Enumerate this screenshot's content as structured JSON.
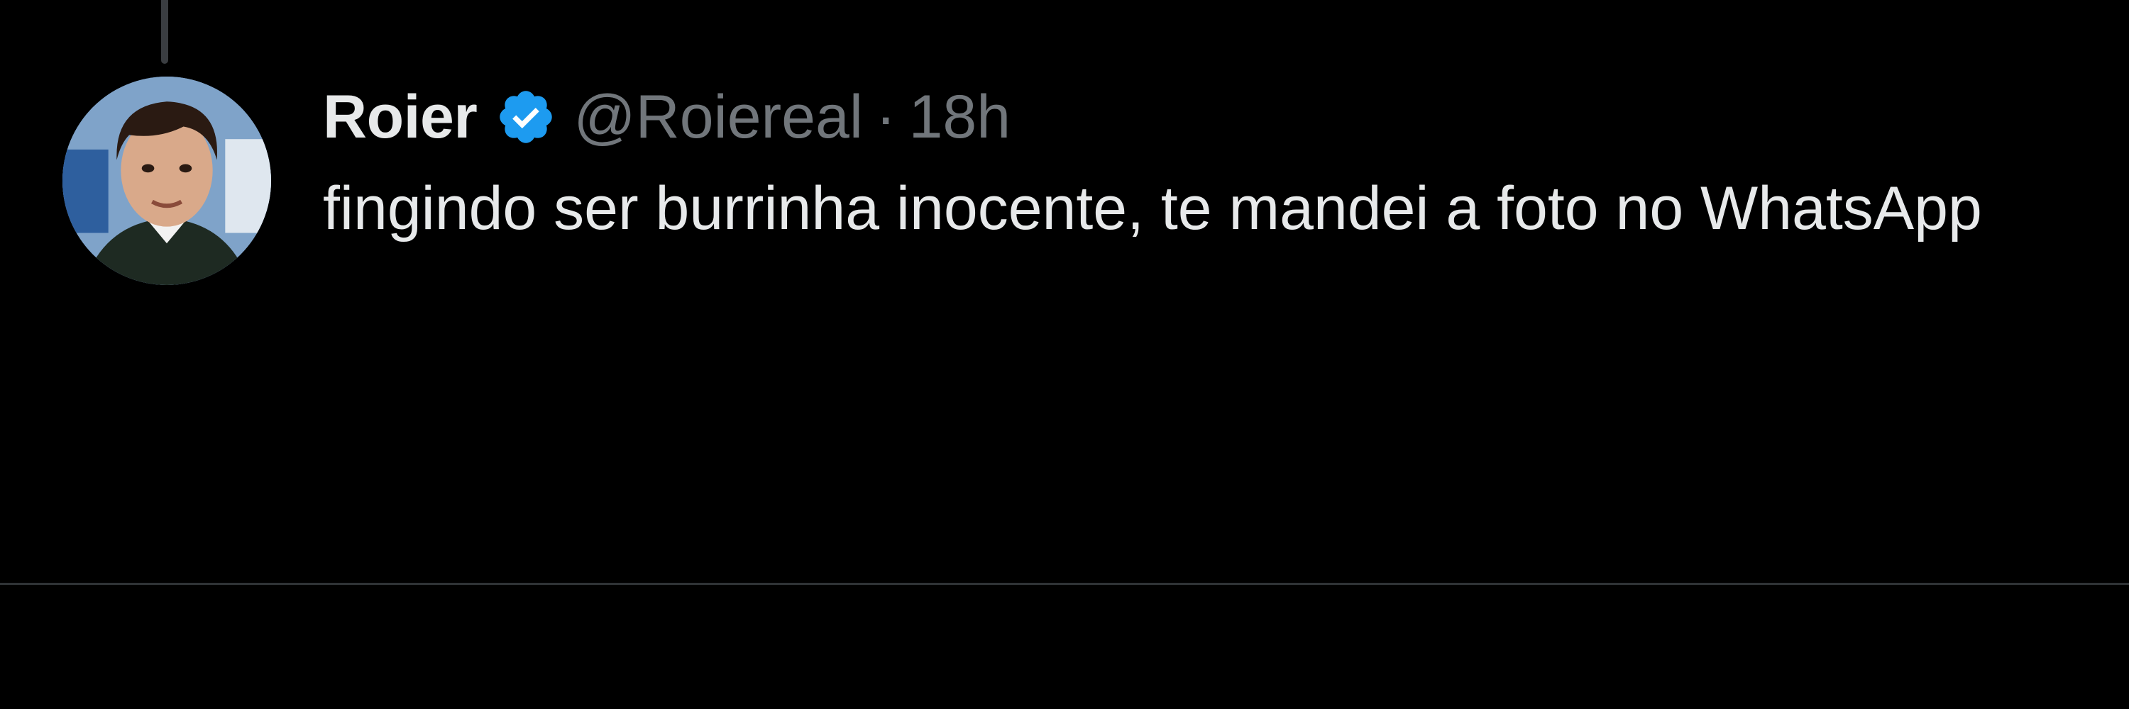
{
  "tweet": {
    "display_name": "Roier",
    "verified_icon": "verified-badge-icon",
    "handle": "@Roiereal",
    "separator": "·",
    "timestamp": "18h",
    "text": "fingindo ser burrinha inocente, te mandei a foto no WhatsApp"
  },
  "colors": {
    "background": "#000000",
    "primary_text": "#e7e9ea",
    "secondary_text": "#71767b",
    "verified_blue": "#1d9bf0",
    "divider": "#2f3336"
  }
}
